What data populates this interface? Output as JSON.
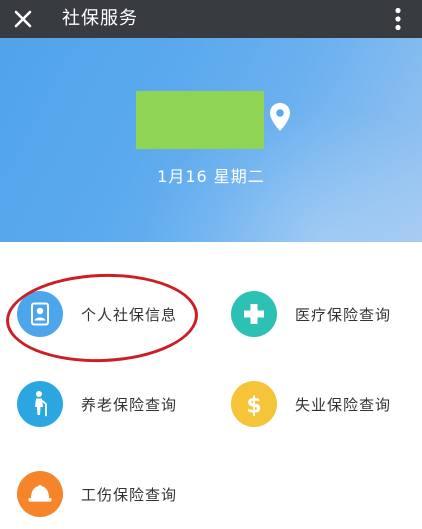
{
  "header": {
    "title": "社保服务",
    "close_icon": "close-icon",
    "more_icon": "more-vertical-icon"
  },
  "hero": {
    "date": "1月16  星期二",
    "location_icon": "location-pin-icon",
    "colors": {
      "gradient_start": "#51a4ea",
      "gradient_end": "#9cc6f1",
      "city_placeholder": "#8fd452"
    }
  },
  "services": [
    {
      "label": "个人社保信息",
      "icon": "id-card-icon",
      "color": "#4da6ec"
    },
    {
      "label": "医疗保险查询",
      "icon": "medical-cross-icon",
      "color": "#2cc1b4"
    },
    {
      "label": "养老保险查询",
      "icon": "elderly-person-icon",
      "color": "#2aa7e0"
    },
    {
      "label": "失业保险查询",
      "icon": "dollar-icon",
      "color": "#f6c438"
    },
    {
      "label": "工伤保险查询",
      "icon": "hard-hat-icon",
      "color": "#f5842a"
    }
  ],
  "annotation": {
    "highlight_color": "#cc1f25"
  }
}
